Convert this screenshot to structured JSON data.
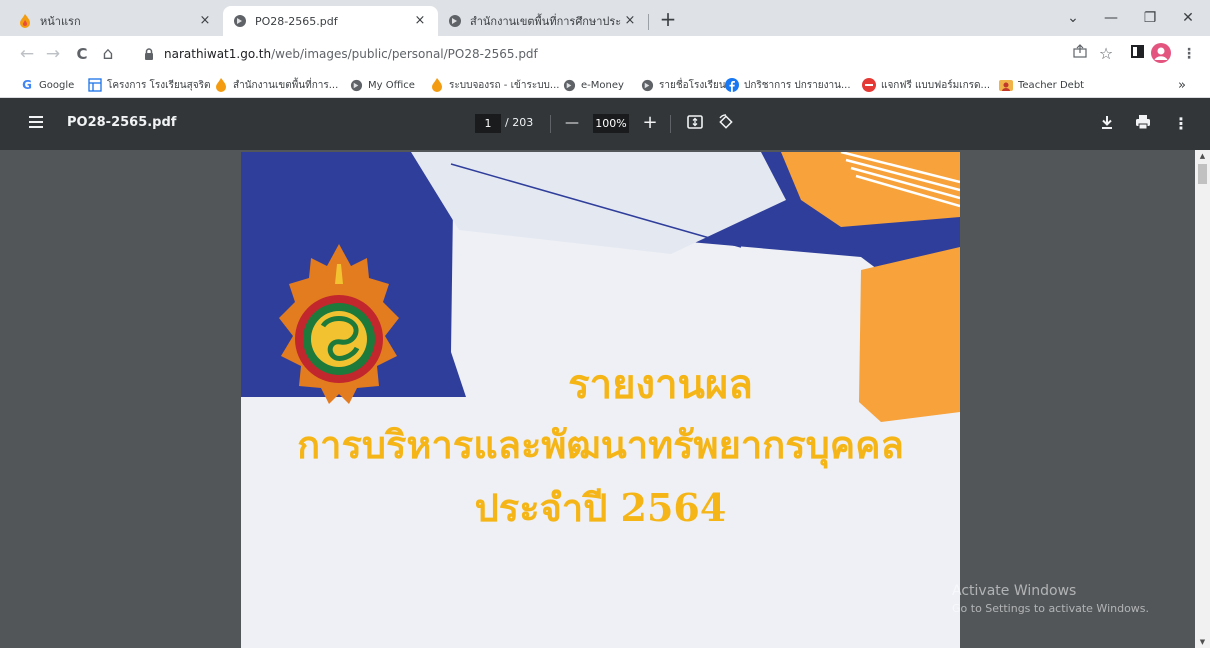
{
  "tabs": [
    {
      "title": "หน้าแรก",
      "icon": "flame-favicon-icon"
    },
    {
      "title": "PO28-2565.pdf",
      "icon": "globe-icon"
    },
    {
      "title": "สำนักงานเขตพื้นที่การศึกษาประถมศึก",
      "icon": "globe-icon"
    }
  ],
  "tab_close_glyph": "×",
  "new_tab_glyph": "+",
  "window_controls": {
    "minimize": "—",
    "maximize": "❐",
    "close": "✕",
    "tab_search": "⌄"
  },
  "nav": {
    "back": "←",
    "forward": "→",
    "reload": "C",
    "home": "⌂"
  },
  "address": {
    "host": "narathiwat1.go.th",
    "path": "/web/images/public/personal/PO28-2565.pdf"
  },
  "toolbar_icons": [
    "share-icon",
    "bookmark-star-icon",
    "side-panel-icon",
    "profile-avatar-icon",
    "more-menu-icon"
  ],
  "bookmarks": [
    {
      "label": "Google",
      "icon": "google-icon"
    },
    {
      "label": "โครงการ โรงเรียนสุจริต",
      "icon": "table-icon"
    },
    {
      "label": "สำนักงานเขตพื้นที่การ...",
      "icon": "flame-favicon-icon"
    },
    {
      "label": "My Office",
      "icon": "globe-icon"
    },
    {
      "label": "ระบบจองรถ - เข้าระบบ...",
      "icon": "flame-favicon-icon"
    },
    {
      "label": "e-Money",
      "icon": "globe-icon"
    },
    {
      "label": "รายชื่อโรงเรียน",
      "icon": "globe-icon"
    },
    {
      "label": "ปกริชาการ ปกรายงาน...",
      "icon": "facebook-icon"
    },
    {
      "label": "แจกฟรี แบบฟอร์มเกรด...",
      "icon": "red-circle-icon"
    },
    {
      "label": "Teacher Debt",
      "icon": "folder-avatar-icon"
    }
  ],
  "bookmarks_overflow": "»",
  "pdf": {
    "filename": "PO28-2565.pdf",
    "current_page": "1",
    "total_pages": "/ 203",
    "zoom": "100%",
    "zoom_out": "—",
    "zoom_in": "+"
  },
  "document": {
    "line1": "รายงานผล",
    "line2": "การบริหารและพัฒนาทรัพยากรบุคคล",
    "line3": "ประจำปี 2564",
    "title_color": "#f5b516",
    "blue": "#2f3e9b",
    "orange": "#f7a23b"
  },
  "watermark": {
    "line1": "Activate Windows",
    "line2": "Go to Settings to activate Windows."
  },
  "scroll": {
    "up": "▲",
    "down": "▼"
  }
}
